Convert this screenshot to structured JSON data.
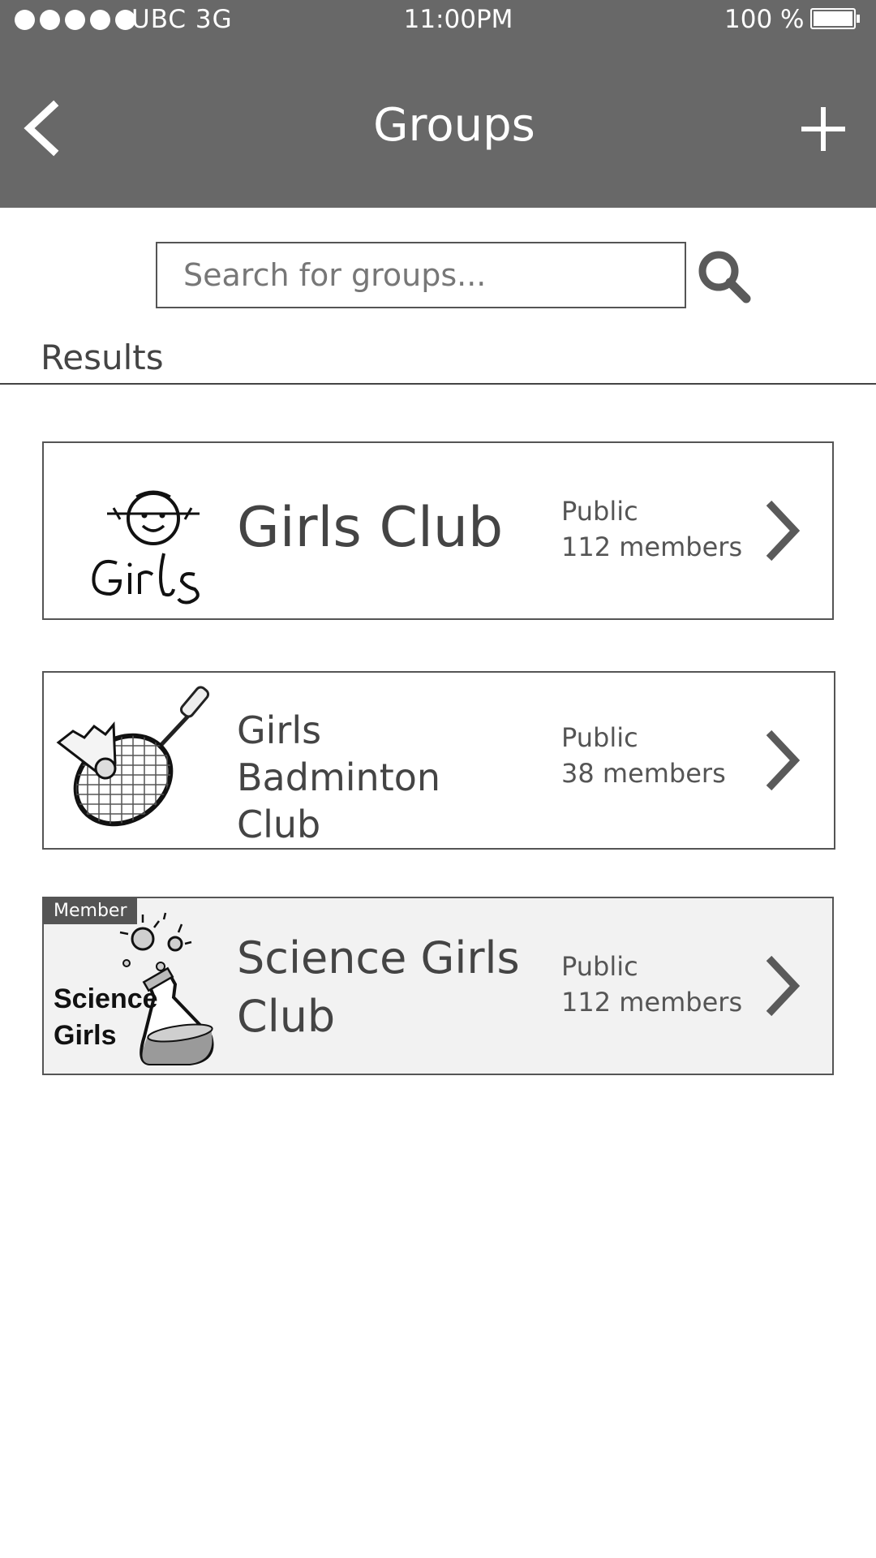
{
  "status_bar": {
    "carrier": "UBC  3G",
    "time": "11:00PM",
    "battery": "100 %"
  },
  "header": {
    "title": "Groups",
    "back_icon": "chevron-left-icon",
    "add_icon": "plus-icon"
  },
  "search": {
    "placeholder": "Search for groups...",
    "value": "",
    "icon": "search-icon"
  },
  "results": {
    "label": "Results",
    "groups": [
      {
        "name": "Girls Club",
        "visibility": "Public",
        "members": "112 members",
        "is_member": false,
        "badge": ""
      },
      {
        "name": "Girls Badminton Club",
        "visibility": "Public",
        "members": "38 members",
        "is_member": false,
        "badge": ""
      },
      {
        "name": "Science Girls Club",
        "visibility": "Public",
        "members": "112 members",
        "is_member": true,
        "badge": "Member",
        "image_text_1": "Science",
        "image_text_2": "Girls"
      }
    ]
  },
  "colors": {
    "header_bg": "#686868",
    "text": "#444444",
    "member_card_bg": "#f2f2f2"
  }
}
